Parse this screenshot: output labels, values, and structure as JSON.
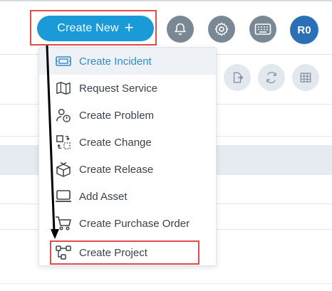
{
  "header": {
    "create_new_label": "Create New",
    "create_new_plus": "+",
    "avatar_initials": "R0",
    "icons": [
      "bell-icon",
      "gear-icon",
      "keyboard-icon"
    ]
  },
  "toolbar": {
    "icons": [
      "export-icon",
      "refresh-icon",
      "grid-icon"
    ]
  },
  "menu": {
    "items": [
      {
        "label": "Create Incident",
        "icon": "incident-icon",
        "active": true
      },
      {
        "label": "Request Service",
        "icon": "map-icon"
      },
      {
        "label": "Create Problem",
        "icon": "problem-icon"
      },
      {
        "label": "Create Change",
        "icon": "change-icon"
      },
      {
        "label": "Create Release",
        "icon": "release-icon"
      },
      {
        "label": "Add Asset",
        "icon": "asset-icon"
      },
      {
        "label": "Create Purchase Order",
        "icon": "cart-icon"
      },
      {
        "label": "Create Project",
        "icon": "project-icon",
        "highlighted": true
      }
    ]
  },
  "colors": {
    "primary": "#1a9ad6",
    "highlight_border": "#e24b4b",
    "icon_bg": "#7a8794",
    "avatar_bg": "#2b6fb6",
    "active_text": "#2f8cc9"
  }
}
